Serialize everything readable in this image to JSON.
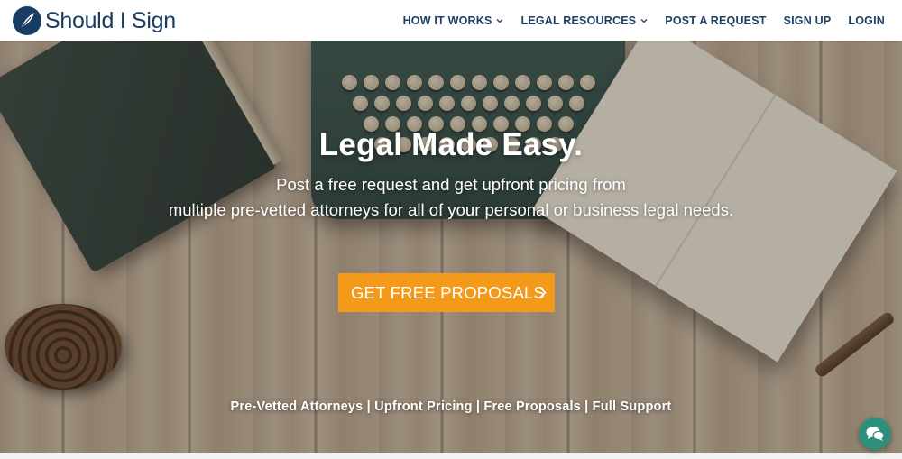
{
  "header": {
    "logo_text": "Should I Sign",
    "logo_icon": "quill-feather-icon",
    "nav": [
      {
        "label": "HOW IT WORKS",
        "has_dropdown": true
      },
      {
        "label": "LEGAL RESOURCES",
        "has_dropdown": true
      },
      {
        "label": "POST A REQUEST",
        "has_dropdown": false
      },
      {
        "label": "SIGN UP",
        "has_dropdown": false
      },
      {
        "label": "LOGIN",
        "has_dropdown": false
      }
    ]
  },
  "hero": {
    "title": "Legal Made Easy.",
    "subtitle_line1": "Post a free request and get upfront pricing from",
    "subtitle_line2": "multiple pre-vetted attorneys for all of your personal or business legal needs.",
    "cta_label": "GET FREE PROPOSALS",
    "tagline": "Pre-Vetted Attorneys | Upfront Pricing | Free Proposals | Full Support"
  },
  "chat": {
    "icon": "chat-bubbles-icon"
  },
  "colors": {
    "brand_navy": "#173d63",
    "nav_text": "#1f3f63",
    "cta_orange": "#f39a1b",
    "chat_teal": "#2f8f7d"
  }
}
